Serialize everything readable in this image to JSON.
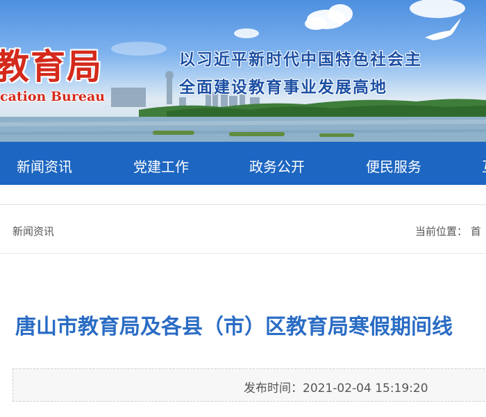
{
  "header": {
    "logo_cn": "教育局",
    "logo_en": "cation Bureau",
    "slogan_line1": "以习近平新时代中国特色社会主",
    "slogan_line2": "全面建设教育事业发展高地"
  },
  "nav": {
    "items": [
      {
        "label": "新闻资讯"
      },
      {
        "label": "党建工作"
      },
      {
        "label": "政务公开"
      },
      {
        "label": "便民服务"
      },
      {
        "label": "互"
      }
    ]
  },
  "breadcrumb": {
    "section": "新闻资讯",
    "location": "当前位置： 首"
  },
  "article": {
    "title": "唐山市教育局及各县（市）区教育局寒假期间线",
    "publish_time": "发布时间：2021-02-04 15:19:20"
  },
  "colors": {
    "nav_bg": "#1d66c1",
    "title": "#2a6cc4",
    "logo": "#d42a1c"
  }
}
